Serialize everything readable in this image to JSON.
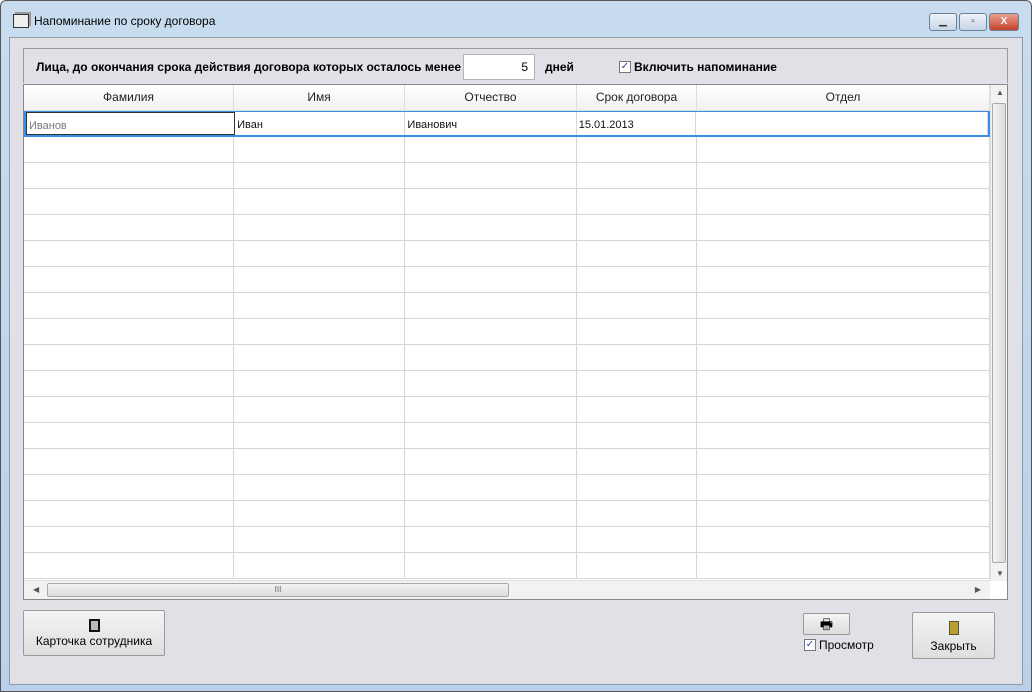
{
  "window": {
    "title": "Напоминание по сроку договора"
  },
  "filter": {
    "label": "Лица, до окончания срока действия договора которых осталось менее",
    "days_value": "5",
    "days_unit": "дней",
    "reminder_label": "Включить напоминание",
    "reminder_checked": true
  },
  "table": {
    "columns": [
      "Фамилия",
      "Имя",
      "Отчество",
      "Срок договора",
      "Отдел"
    ],
    "rows": [
      [
        "Иванов",
        "Иван",
        "Иванович",
        "15.01.2013",
        ""
      ]
    ]
  },
  "buttons": {
    "card": "Карточка сотрудника",
    "preview": "Просмотр",
    "preview_checked": true,
    "close": "Закрыть"
  }
}
